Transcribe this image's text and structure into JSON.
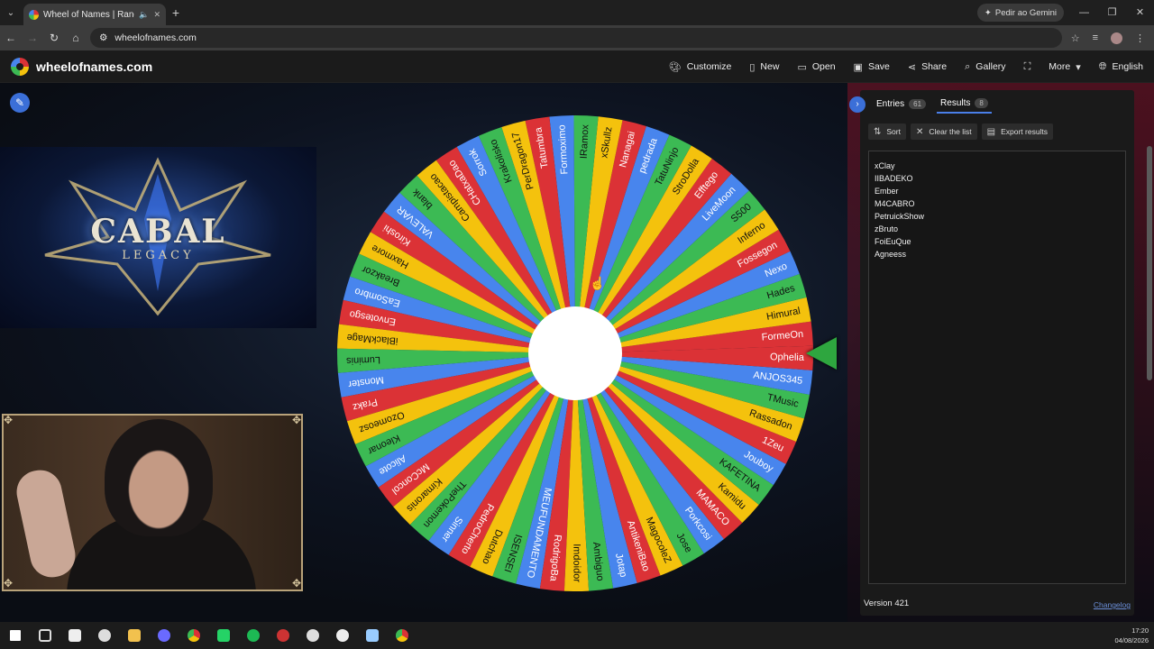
{
  "browser": {
    "tab_title": "Wheel of Names | Random",
    "url": "wheelofnames.com",
    "gemini_label": "Pedir ao Gemini"
  },
  "site": {
    "logo": "wheelofnames.com",
    "menu": [
      {
        "label": "Customize",
        "icon": "palette-icon"
      },
      {
        "label": "New",
        "icon": "new-file-icon"
      },
      {
        "label": "Open",
        "icon": "folder-icon"
      },
      {
        "label": "Save",
        "icon": "save-icon"
      },
      {
        "label": "Share",
        "icon": "share-icon"
      },
      {
        "label": "Gallery",
        "icon": "search-icon"
      },
      {
        "label": "",
        "icon": "fullscreen-icon"
      },
      {
        "label": "More",
        "icon": "chevron-down-icon"
      },
      {
        "label": "English",
        "icon": "globe-icon"
      }
    ]
  },
  "banner": {
    "title": "CABAL",
    "subtitle": "LEGACY"
  },
  "wheel": {
    "colors": [
      "#db3236",
      "#f4c20d",
      "#3cba54",
      "#4885ed"
    ],
    "names": [
      "FormeOn",
      "Himural",
      "Hades",
      "Nexo",
      "Fossegon",
      "Inferno",
      "S500",
      "LiveMoon",
      "Efftego",
      "StroDolla",
      "TatuNinjo",
      "pedrada",
      "Nanagai",
      "xSkullz",
      "IRamox",
      "Formoximo",
      "Tatumbra",
      "PerDragon17",
      "Krakolisko",
      "Sorrok",
      "CHatxaDao",
      "Campistacao",
      "blank",
      "VALEVAR",
      "Kiroshi",
      "Haxmore",
      "Breakzor",
      "EaSombro",
      "Envotesgo",
      "iBlackMage",
      "Luminis",
      "Monster",
      "Prakz",
      "Ozomeosz",
      "Kleonar",
      "Alicote",
      "McConcol",
      "Kimaronis",
      "ThePokemon",
      "Sinner",
      "PedroCherto",
      "Dutchao",
      "ISENSEI",
      "MEUFUNDAMENTO",
      "RodrigoBa",
      "Imdoidor",
      "Ambiguo",
      "Jotap",
      "AntikeniBao",
      "MagocoleZ",
      "Jose",
      "Porkcosi",
      "MAMACO",
      "Kamidu",
      "KAFETINA",
      "Jouboy",
      "1Zeu",
      "Rassadon",
      "TMusic",
      "ANJOS345",
      "Ophelia"
    ]
  },
  "panel": {
    "entries_label": "Entries",
    "entries_count": "61",
    "results_label": "Results",
    "results_count": "8",
    "sort_label": "Sort",
    "clear_label": "Clear the list",
    "export_label": "Export results",
    "results": [
      "xClay",
      "IIBADEKO",
      "Ember",
      "M4CABRO",
      "PetruickShow",
      "zBruto",
      "FoiEuQue",
      "Agneess"
    ],
    "version": "Version 421",
    "changelog": "Changelog"
  },
  "taskbar": {
    "time": "17:20",
    "date": "04/08/2026"
  }
}
